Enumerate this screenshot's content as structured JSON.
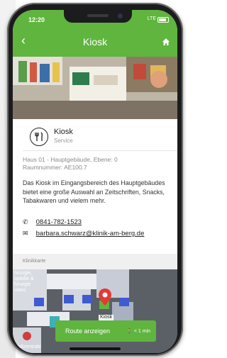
{
  "status_bar": {
    "time": "12:20",
    "network": "LTE"
  },
  "nav": {
    "title": "Kiosk"
  },
  "place": {
    "name": "Kiosk",
    "category": "Service",
    "location_line1": "Haus 01 - Hauptgebäude, Ebene: 0",
    "location_line2": "Raumnummer:  AE100.7",
    "description": "Das Kiosk im Eingangsbereich des Hauptgebäudes bietet eine große Auswahl an Zeitschriften, Snacks, Tabakwaren und vielem mehr.",
    "phone": "0841-782-1523",
    "email": "barbara.schwarz@klinik-am-berg.de"
  },
  "map": {
    "section_label": "Klinikkarte",
    "area_label_lines": [
      "hirurgie,",
      "opädie &",
      "hirurgie",
      "ulanz"
    ],
    "marker_label": "Kiosk",
    "bottom_label": "otfallzentrale",
    "route_button": "Route anzeigen",
    "route_time": "< 1 min"
  },
  "colors": {
    "brand_green": "#5fb53e",
    "marker_red": "#e53935",
    "map_bg": "#5e6368"
  }
}
